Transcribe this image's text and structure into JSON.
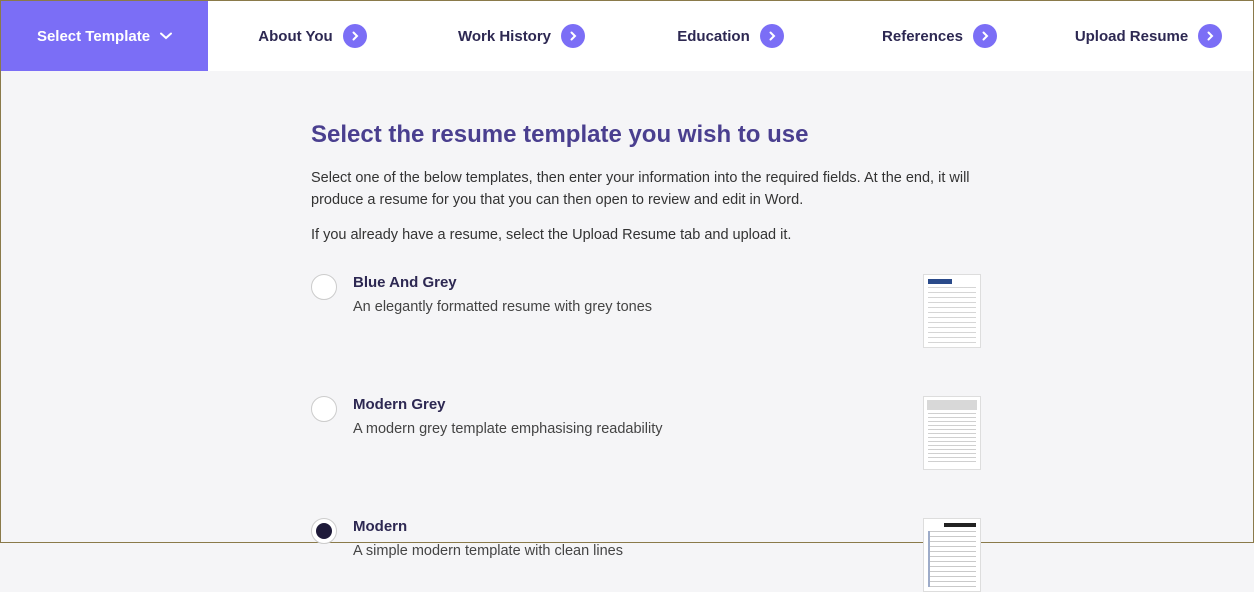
{
  "nav": {
    "active": "Select Template",
    "items": [
      "About You",
      "Work History",
      "Education",
      "References",
      "Upload Resume"
    ]
  },
  "page": {
    "heading": "Select the resume template you wish to use",
    "intro1": "Select one of the below templates, then enter your information into the required fields. At the end, it will produce a resume for you that you can then open to review and edit in Word.",
    "intro2": "If you already have a resume, select the Upload Resume tab and upload it."
  },
  "templates": [
    {
      "title": "Blue And Grey",
      "desc": "An elegantly formatted resume with grey tones",
      "selected": false,
      "thumb": "blue"
    },
    {
      "title": "Modern Grey",
      "desc": "A modern grey template emphasising readability",
      "selected": false,
      "thumb": "grey"
    },
    {
      "title": "Modern",
      "desc": "A simple modern template with clean lines",
      "selected": true,
      "thumb": "modern"
    }
  ]
}
